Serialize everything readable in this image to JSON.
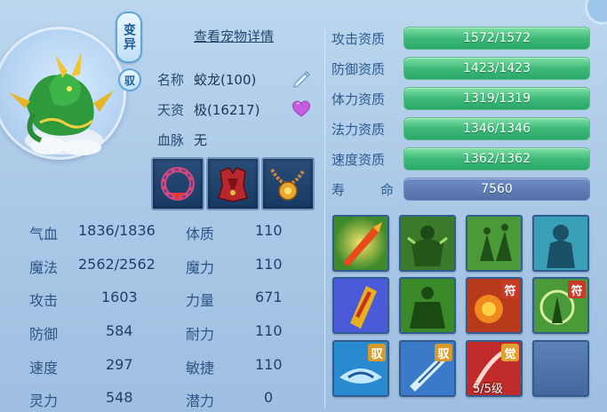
{
  "badges": {
    "mutation": "变异",
    "tame": "驭"
  },
  "detail_link": "查看宠物详情",
  "pet": {
    "name_label": "名称",
    "name_value": "蛟龙(100)",
    "talent_label": "天资",
    "talent_value": "极(16217)",
    "bloodline_label": "血脉",
    "bloodline_value": "无"
  },
  "equipment": [
    "collar-icon",
    "armor-icon",
    "amulet-icon"
  ],
  "stats_left": [
    {
      "label": "气血",
      "value": "1836/1836"
    },
    {
      "label": "魔法",
      "value": "2562/2562"
    },
    {
      "label": "攻击",
      "value": "1603"
    },
    {
      "label": "防御",
      "value": "584"
    },
    {
      "label": "速度",
      "value": "297"
    },
    {
      "label": "灵力",
      "value": "548"
    }
  ],
  "stats_right": [
    {
      "label": "体质",
      "value": "110"
    },
    {
      "label": "魔力",
      "value": "110"
    },
    {
      "label": "力量",
      "value": "671"
    },
    {
      "label": "耐力",
      "value": "110"
    },
    {
      "label": "敏捷",
      "value": "110"
    },
    {
      "label": "潜力",
      "value": "0"
    }
  ],
  "aptitudes": [
    {
      "label": "攻击资质",
      "value": "1572/1572",
      "fill": 1.0
    },
    {
      "label": "防御资质",
      "value": "1423/1423",
      "fill": 1.0
    },
    {
      "label": "体力资质",
      "value": "1319/1319",
      "fill": 1.0
    },
    {
      "label": "法力资质",
      "value": "1346/1346",
      "fill": 1.0
    },
    {
      "label": "速度资质",
      "value": "1362/1362",
      "fill": 1.0
    }
  ],
  "lifespan": {
    "label_a": "寿",
    "label_b": "命",
    "value": "7560"
  },
  "skills": [
    {
      "icon": "fire-sword-skill-icon"
    },
    {
      "icon": "green-titan-skill-icon"
    },
    {
      "icon": "green-warriors-skill-icon"
    },
    {
      "icon": "blue-spirit-skill-icon"
    },
    {
      "icon": "talisman-strike-skill-icon"
    },
    {
      "icon": "green-golem-skill-icon"
    },
    {
      "icon": "fire-fist-skill-icon",
      "tag": "符"
    },
    {
      "icon": "green-shield-skill-icon",
      "tag": "符"
    },
    {
      "icon": "ice-dragon-skill-icon",
      "tag": "驭"
    },
    {
      "icon": "ice-blade-skill-icon",
      "tag": "驭"
    },
    {
      "icon": "red-slash-skill-icon",
      "tag": "觉",
      "level": "5/5级"
    },
    {
      "icon": "empty-skill-slot"
    }
  ],
  "colors": {
    "bar_green": "#3eb978",
    "bar_life": "#556fa9",
    "accent": "#2e5a8e"
  }
}
